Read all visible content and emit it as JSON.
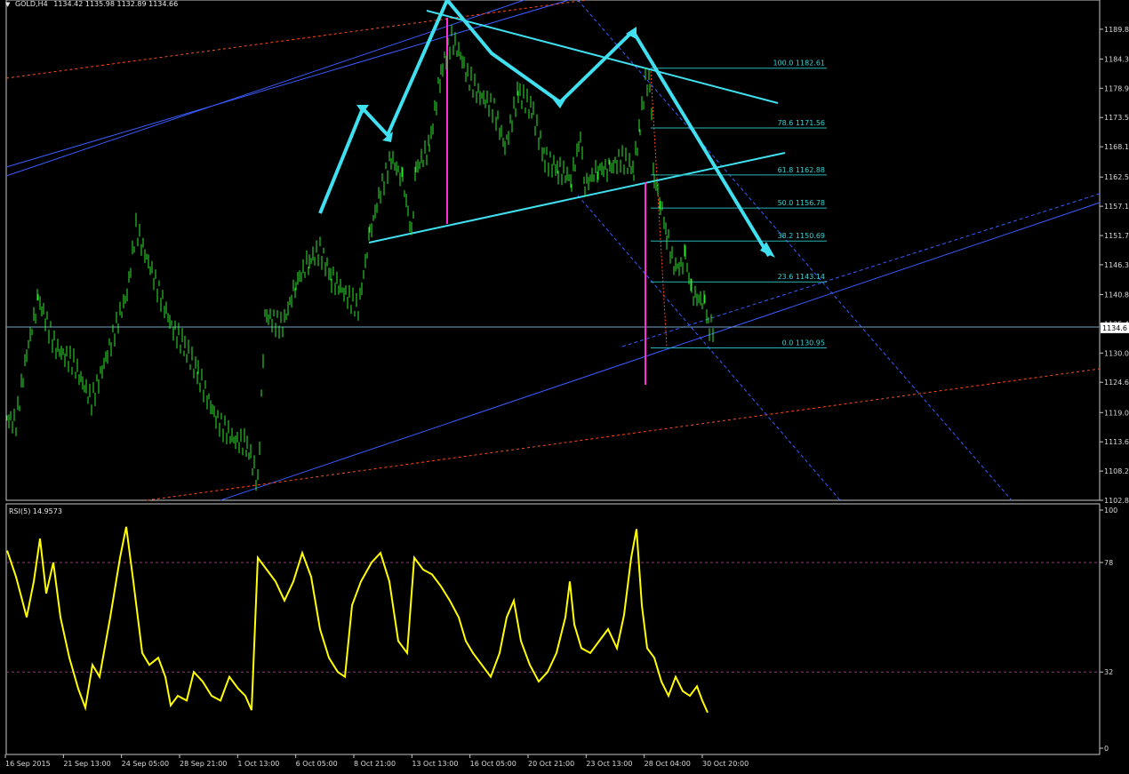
{
  "header": {
    "symbol_label": "GOLD,H4",
    "ohlc": "1134.42 1135.98 1132.89 1134.66",
    "arrow_icon": "triangle-down-icon"
  },
  "rsi_header": {
    "label": "RSI(5) 14.9573"
  },
  "chart_data": [
    {
      "type": "candlestick",
      "title": "GOLD,H4",
      "price_axis_ticks": [
        "1189.8",
        "1184.3",
        "1178.9",
        "1173.5",
        "1168.1",
        "1162.5",
        "1157.1",
        "1151.7",
        "1146.3",
        "1140.8",
        "1135.4",
        "1130.0",
        "1124.6",
        "1119.0",
        "1113.6",
        "1108.2",
        "1102.8"
      ],
      "ylim": [
        1102.8,
        1195.2
      ],
      "current_price_label": "1134.6",
      "time_axis_labels": [
        "16 Sep 2015",
        "21 Sep 13:00",
        "24 Sep 05:00",
        "28 Sep 21:00",
        "1 Oct 13:00",
        "6 Oct 05:00",
        "8 Oct 21:00",
        "13 Oct 13:00",
        "16 Oct 05:00",
        "20 Oct 21:00",
        "23 Oct 13:00",
        "28 Oct 04:00",
        "30 Oct 20:00"
      ],
      "close_path_anchors": [
        [
          0,
          1118
        ],
        [
          10,
          1117
        ],
        [
          22,
          1130
        ],
        [
          35,
          1140
        ],
        [
          55,
          1131
        ],
        [
          75,
          1128
        ],
        [
          95,
          1121
        ],
        [
          115,
          1131
        ],
        [
          135,
          1141
        ],
        [
          145,
          1153
        ],
        [
          165,
          1144
        ],
        [
          185,
          1135
        ],
        [
          200,
          1131
        ],
        [
          215,
          1126
        ],
        [
          235,
          1118
        ],
        [
          255,
          1114
        ],
        [
          270,
          1113
        ],
        [
          282,
          1106
        ],
        [
          290,
          1137
        ],
        [
          310,
          1135
        ],
        [
          325,
          1143
        ],
        [
          340,
          1147
        ],
        [
          352,
          1149
        ],
        [
          365,
          1144
        ],
        [
          385,
          1140
        ],
        [
          395,
          1138
        ],
        [
          408,
          1152
        ],
        [
          420,
          1160
        ],
        [
          432,
          1166
        ],
        [
          445,
          1162
        ],
        [
          455,
          1152
        ],
        [
          460,
          1164
        ],
        [
          475,
          1168
        ],
        [
          488,
          1182
        ],
        [
          500,
          1188
        ],
        [
          510,
          1185
        ],
        [
          518,
          1181
        ],
        [
          530,
          1178
        ],
        [
          548,
          1175
        ],
        [
          560,
          1168
        ],
        [
          575,
          1178
        ],
        [
          590,
          1175
        ],
        [
          605,
          1166
        ],
        [
          620,
          1164
        ],
        [
          635,
          1162
        ],
        [
          645,
          1170
        ],
        [
          650,
          1161
        ],
        [
          665,
          1164
        ],
        [
          678,
          1164
        ],
        [
          690,
          1166
        ],
        [
          705,
          1164
        ],
        [
          712,
          1172
        ],
        [
          718,
          1180
        ],
        [
          723,
          1180
        ],
        [
          728,
          1162
        ],
        [
          735,
          1158
        ],
        [
          742,
          1152
        ],
        [
          750,
          1146
        ],
        [
          758,
          1146
        ],
        [
          763,
          1148
        ],
        [
          770,
          1141
        ],
        [
          778,
          1140
        ],
        [
          785,
          1139
        ],
        [
          790,
          1135
        ],
        [
          795,
          1134.66
        ]
      ],
      "fibonacci": [
        {
          "level": "100.0",
          "price": "1182.61"
        },
        {
          "level": "78.6",
          "price": "1171.56"
        },
        {
          "level": "61.8",
          "price": "1162.88"
        },
        {
          "level": "50.0",
          "price": "1156.78"
        },
        {
          "level": "38.2",
          "price": "1150.69"
        },
        {
          "level": "23.6",
          "price": "1143.14"
        },
        {
          "level": "0.0",
          "price": "1130.95"
        }
      ]
    },
    {
      "type": "line",
      "title": "RSI(5) 14.9573",
      "ylim": [
        0,
        100
      ],
      "y_ticks": [
        "100",
        "78",
        "32",
        "0"
      ],
      "levels": [
        78,
        32
      ],
      "series": [
        {
          "name": "RSI(5)",
          "color": "#ffff00",
          "points": [
            [
              8,
              83
            ],
            [
              18,
              72
            ],
            [
              30,
              55
            ],
            [
              38,
              70
            ],
            [
              45,
              88
            ],
            [
              52,
              65
            ],
            [
              60,
              78
            ],
            [
              68,
              55
            ],
            [
              78,
              38
            ],
            [
              88,
              25
            ],
            [
              96,
              17
            ],
            [
              104,
              35
            ],
            [
              112,
              30
            ],
            [
              124,
              55
            ],
            [
              135,
              80
            ],
            [
              142,
              93
            ],
            [
              150,
              70
            ],
            [
              160,
              40
            ],
            [
              168,
              35
            ],
            [
              178,
              38
            ],
            [
              186,
              30
            ],
            [
              192,
              18
            ],
            [
              200,
              22
            ],
            [
              210,
              20
            ],
            [
              218,
              32
            ],
            [
              228,
              28
            ],
            [
              238,
              22
            ],
            [
              248,
              20
            ],
            [
              258,
              30
            ],
            [
              268,
              25
            ],
            [
              276,
              22
            ],
            [
              283,
              16
            ],
            [
              290,
              80
            ],
            [
              300,
              75
            ],
            [
              310,
              70
            ],
            [
              320,
              62
            ],
            [
              330,
              70
            ],
            [
              340,
              82
            ],
            [
              350,
              72
            ],
            [
              360,
              50
            ],
            [
              370,
              38
            ],
            [
              380,
              32
            ],
            [
              388,
              30
            ],
            [
              396,
              60
            ],
            [
              406,
              70
            ],
            [
              418,
              78
            ],
            [
              428,
              82
            ],
            [
              438,
              70
            ],
            [
              448,
              45
            ],
            [
              458,
              40
            ],
            [
              466,
              80
            ],
            [
              476,
              75
            ],
            [
              486,
              73
            ],
            [
              496,
              68
            ],
            [
              506,
              62
            ],
            [
              516,
              55
            ],
            [
              524,
              45
            ],
            [
              532,
              40
            ],
            [
              542,
              35
            ],
            [
              552,
              30
            ],
            [
              562,
              40
            ],
            [
              570,
              55
            ],
            [
              578,
              62
            ],
            [
              586,
              45
            ],
            [
              596,
              35
            ],
            [
              606,
              28
            ],
            [
              616,
              32
            ],
            [
              626,
              40
            ],
            [
              636,
              55
            ],
            [
              641,
              70
            ],
            [
              646,
              52
            ],
            [
              654,
              42
            ],
            [
              664,
              40
            ],
            [
              674,
              45
            ],
            [
              684,
              50
            ],
            [
              694,
              42
            ],
            [
              702,
              56
            ],
            [
              710,
              80
            ],
            [
              716,
              92
            ],
            [
              722,
              60
            ],
            [
              728,
              42
            ],
            [
              736,
              38
            ],
            [
              744,
              28
            ],
            [
              752,
              22
            ],
            [
              760,
              30
            ],
            [
              768,
              24
            ],
            [
              776,
              22
            ],
            [
              784,
              26
            ],
            [
              790,
              20
            ],
            [
              796,
              15
            ]
          ]
        }
      ]
    }
  ]
}
